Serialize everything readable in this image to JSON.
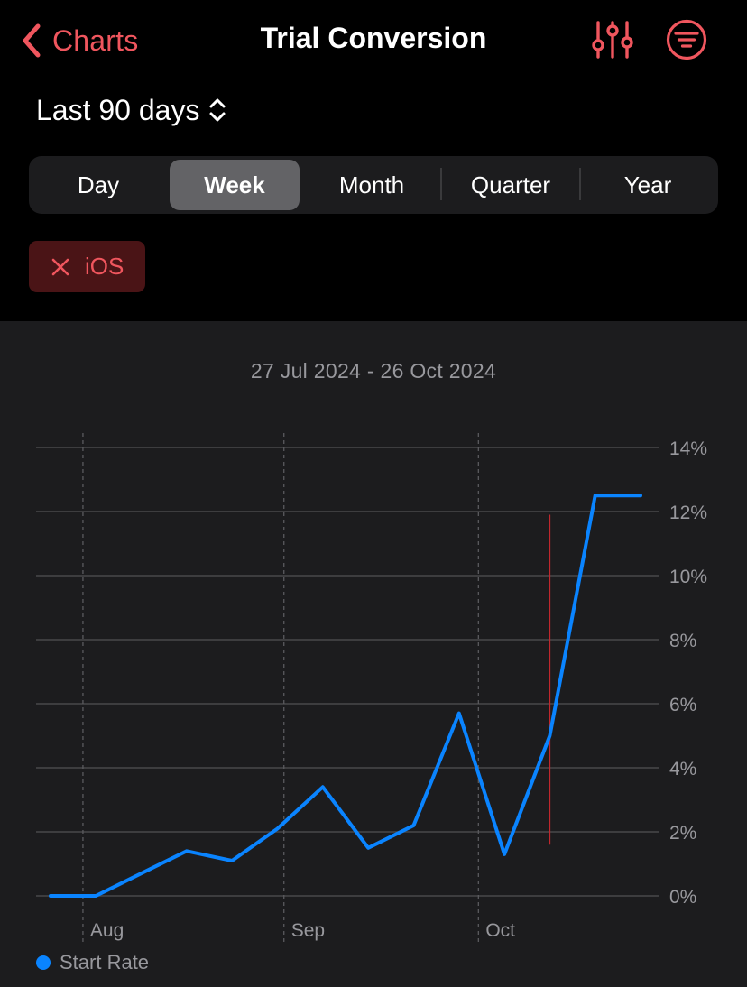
{
  "nav": {
    "back_label": "Charts",
    "title": "Trial Conversion",
    "adjust_icon": "sliders-icon",
    "filter_icon": "filter-circle-icon"
  },
  "range": {
    "label": "Last 90 days"
  },
  "segments": [
    {
      "label": "Day",
      "selected": false
    },
    {
      "label": "Week",
      "selected": true
    },
    {
      "label": "Month",
      "selected": false
    },
    {
      "label": "Quarter",
      "selected": false
    },
    {
      "label": "Year",
      "selected": false
    }
  ],
  "filter_chip": {
    "label": "iOS",
    "icon": "close-icon"
  },
  "colors": {
    "accent": "#f0565e",
    "series": "#0a84ff",
    "background": "#000000",
    "panel": "#1c1c1e",
    "marker": "#c1272d"
  },
  "chart_data": {
    "type": "line",
    "date_range": "27 Jul 2024 - 26 Oct 2024",
    "x_ticks": [
      "Aug",
      "Sep",
      "Oct"
    ],
    "x_tick_dates": [
      "2024-08-01",
      "2024-09-01",
      "2024-10-01"
    ],
    "x_range": [
      "2024-07-27",
      "2024-10-26"
    ],
    "y_ticks": [
      "0%",
      "2%",
      "4%",
      "6%",
      "8%",
      "10%",
      "12%",
      "14%"
    ],
    "ylim": [
      0,
      14
    ],
    "grid": true,
    "legend_position": "bottom-left",
    "series": [
      {
        "name": "Start Rate",
        "color": "#0a84ff",
        "points": [
          {
            "x": "2024-07-27",
            "y": 0.0
          },
          {
            "x": "2024-08-03",
            "y": 0.0
          },
          {
            "x": "2024-08-10",
            "y": 0.7
          },
          {
            "x": "2024-08-17",
            "y": 1.4
          },
          {
            "x": "2024-08-24",
            "y": 1.1
          },
          {
            "x": "2024-08-31",
            "y": 2.1
          },
          {
            "x": "2024-09-07",
            "y": 3.4
          },
          {
            "x": "2024-09-14",
            "y": 1.5
          },
          {
            "x": "2024-09-21",
            "y": 2.2
          },
          {
            "x": "2024-09-28",
            "y": 5.7
          },
          {
            "x": "2024-10-05",
            "y": 1.3
          },
          {
            "x": "2024-10-12",
            "y": 5.0
          },
          {
            "x": "2024-10-19",
            "y": 12.5
          },
          {
            "x": "2024-10-26",
            "y": 12.5
          }
        ]
      }
    ],
    "marker": {
      "x": "2024-10-12",
      "y_from": 1.6,
      "y_to": 11.9
    }
  }
}
